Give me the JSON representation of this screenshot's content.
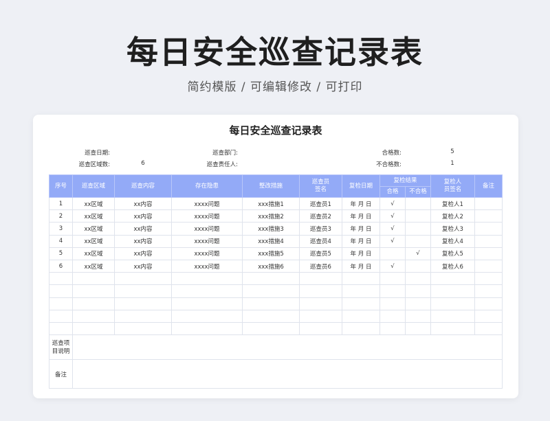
{
  "header": {
    "title": "每日安全巡查记录表",
    "subtitle": "简约模版 / 可编辑修改 / 可打印"
  },
  "sheet": {
    "title": "每日安全巡查记录表",
    "info": {
      "date_label": "巡查日期:",
      "dept_label": "巡查部门:",
      "pass_label": "合格数:",
      "pass_value": "5",
      "area_label": "巡查区域数:",
      "area_value": "6",
      "owner_label": "巡查责任人:",
      "fail_label": "不合格数:",
      "fail_value": "1"
    },
    "columns": {
      "no": "序号",
      "area": "巡查区域",
      "content": "巡查内容",
      "issue": "存在隐患",
      "measure": "整改措施",
      "inspector": "巡查员签名",
      "recheck_date": "复检日期",
      "result": "复检结果",
      "pass": "合格",
      "fail": "不合格",
      "rechecker": "复检人员签名",
      "remark": "备注"
    },
    "rows": [
      {
        "no": "1",
        "area": "xx区域",
        "content": "xx内容",
        "issue": "xxxx问题",
        "measure": "xxx措施1",
        "inspector": "巡查员1",
        "date": "年 月 日",
        "pass": "√",
        "fail": "",
        "rechecker": "复检人1",
        "remark": ""
      },
      {
        "no": "2",
        "area": "xx区域",
        "content": "xx内容",
        "issue": "xxxx问题",
        "measure": "xxx措施2",
        "inspector": "巡查员2",
        "date": "年 月 日",
        "pass": "√",
        "fail": "",
        "rechecker": "复检人2",
        "remark": ""
      },
      {
        "no": "3",
        "area": "xx区域",
        "content": "xx内容",
        "issue": "xxxx问题",
        "measure": "xxx措施3",
        "inspector": "巡查员3",
        "date": "年 月 日",
        "pass": "√",
        "fail": "",
        "rechecker": "复检人3",
        "remark": ""
      },
      {
        "no": "4",
        "area": "xx区域",
        "content": "xx内容",
        "issue": "xxxx问题",
        "measure": "xxx措施4",
        "inspector": "巡查员4",
        "date": "年 月 日",
        "pass": "√",
        "fail": "",
        "rechecker": "复检人4",
        "remark": ""
      },
      {
        "no": "5",
        "area": "xx区域",
        "content": "xx内容",
        "issue": "xxxx问题",
        "measure": "xxx措施5",
        "inspector": "巡查员5",
        "date": "年 月 日",
        "pass": "",
        "fail": "√",
        "rechecker": "复检人5",
        "remark": ""
      },
      {
        "no": "6",
        "area": "xx区域",
        "content": "xx内容",
        "issue": "xxxx问题",
        "measure": "xxx措施6",
        "inspector": "巡查员6",
        "date": "年 月 日",
        "pass": "√",
        "fail": "",
        "rechecker": "复检人6",
        "remark": ""
      }
    ],
    "footer": {
      "notes_label": "巡查项目说明",
      "remark_label": "备注"
    }
  },
  "colors": {
    "header_bg": "#93aaf7",
    "page_bg": "#eef0f5",
    "grid_line": "#dfe3ec"
  }
}
